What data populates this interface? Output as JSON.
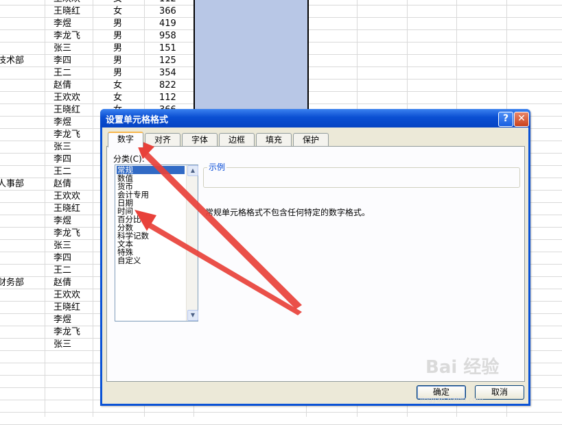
{
  "sheet": {
    "dept_labels": [
      {
        "text": "技术部",
        "row": 5
      },
      {
        "text": "人事部",
        "row": 15
      },
      {
        "text": "财务部",
        "row": 23
      }
    ],
    "rows": [
      {
        "name": "王欢欢",
        "gender": "女",
        "value": "112"
      },
      {
        "name": "王晓红",
        "gender": "女",
        "value": "366"
      },
      {
        "name": "李煜",
        "gender": "男",
        "value": "419"
      },
      {
        "name": "李龙飞",
        "gender": "男",
        "value": "958"
      },
      {
        "name": "张三",
        "gender": "男",
        "value": "151"
      },
      {
        "name": "李四",
        "gender": "男",
        "value": "125"
      },
      {
        "name": "王二",
        "gender": "男",
        "value": "354"
      },
      {
        "name": "赵倩",
        "gender": "女",
        "value": "822"
      },
      {
        "name": "王欢欢",
        "gender": "女",
        "value": "112"
      },
      {
        "name": "王晓红",
        "gender": "女",
        "value": "366"
      },
      {
        "name": "李煜",
        "gender": "",
        "value": ""
      },
      {
        "name": "李龙飞",
        "gender": "",
        "value": ""
      },
      {
        "name": "张三",
        "gender": "",
        "value": ""
      },
      {
        "name": "李四",
        "gender": "",
        "value": ""
      },
      {
        "name": "王二",
        "gender": "",
        "value": ""
      },
      {
        "name": "赵倩",
        "gender": "",
        "value": ""
      },
      {
        "name": "王欢欢",
        "gender": "",
        "value": ""
      },
      {
        "name": "王晓红",
        "gender": "",
        "value": ""
      },
      {
        "name": "李煜",
        "gender": "",
        "value": ""
      },
      {
        "name": "李龙飞",
        "gender": "",
        "value": ""
      },
      {
        "name": "张三",
        "gender": "",
        "value": ""
      },
      {
        "name": "李四",
        "gender": "",
        "value": ""
      },
      {
        "name": "王二",
        "gender": "",
        "value": ""
      },
      {
        "name": "赵倩",
        "gender": "",
        "value": ""
      },
      {
        "name": "王欢欢",
        "gender": "",
        "value": ""
      },
      {
        "name": "王晓红",
        "gender": "",
        "value": ""
      },
      {
        "name": "李煜",
        "gender": "",
        "value": ""
      },
      {
        "name": "李龙飞",
        "gender": "",
        "value": ""
      },
      {
        "name": "张三",
        "gender": "",
        "value": ""
      }
    ]
  },
  "dialog": {
    "title": "设置单元格格式",
    "help": "?",
    "close": "✕",
    "tabs": [
      "数字",
      "对齐",
      "字体",
      "边框",
      "填充",
      "保护"
    ],
    "category_label": "分类(C):",
    "categories": [
      "常规",
      "数值",
      "货币",
      "会计专用",
      "日期",
      "时间",
      "百分比",
      "分数",
      "科学记数",
      "文本",
      "特殊",
      "自定义"
    ],
    "selected_category": "常规",
    "sample_label": "示例",
    "description": "常规单元格格式不包含任何特定的数字格式。",
    "ok": "确定",
    "cancel": "取消"
  },
  "watermark": {
    "text": "Bai 经验",
    "url": "jingyan.baidu.com"
  },
  "colors": {
    "title_blue": "#0a52d6",
    "dialog_bg": "#ece9d8",
    "selection": "#316ac5",
    "arrow": "#e8413a",
    "column_fill": "#b8c7e6"
  }
}
